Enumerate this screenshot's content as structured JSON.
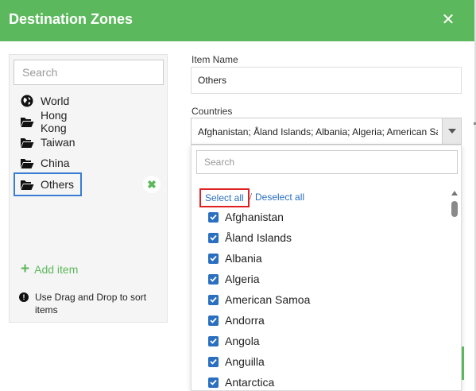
{
  "dialog": {
    "title": "Destination Zones",
    "close_icon": "close-icon",
    "accent_color": "#5cb85c"
  },
  "left_panel": {
    "search_placeholder": "Search",
    "zones": [
      {
        "label": "World",
        "icon": "globe-icon"
      },
      {
        "label": "Hong Kong",
        "icon": "folder-open-icon"
      },
      {
        "label": "Taiwan",
        "icon": "folder-open-icon"
      },
      {
        "label": "China",
        "icon": "folder-open-icon"
      },
      {
        "label": "Others",
        "icon": "folder-open-icon",
        "selected": true
      }
    ],
    "remove_icon": "remove-x-icon",
    "add_item_label": "Add item",
    "hint": "Use Drag and Drop to sort items"
  },
  "form": {
    "item_name_label": "Item Name",
    "item_name_value": "Others",
    "countries_label": "Countries",
    "countries_value": "Afghanistan; Åland Islands; Albania; Algeria; American Samoa"
  },
  "dropdown": {
    "search_placeholder": "Search",
    "select_all_label": "Select all",
    "separator": "/",
    "deselect_all_label": "Deselect all",
    "countries": [
      {
        "name": "Afghanistan",
        "checked": true
      },
      {
        "name": "Åland Islands",
        "checked": true
      },
      {
        "name": "Albania",
        "checked": true
      },
      {
        "name": "Algeria",
        "checked": true
      },
      {
        "name": "American Samoa",
        "checked": true
      },
      {
        "name": "Andorra",
        "checked": true
      },
      {
        "name": "Angola",
        "checked": true
      },
      {
        "name": "Anguilla",
        "checked": true
      },
      {
        "name": "Antarctica",
        "checked": true
      }
    ]
  }
}
